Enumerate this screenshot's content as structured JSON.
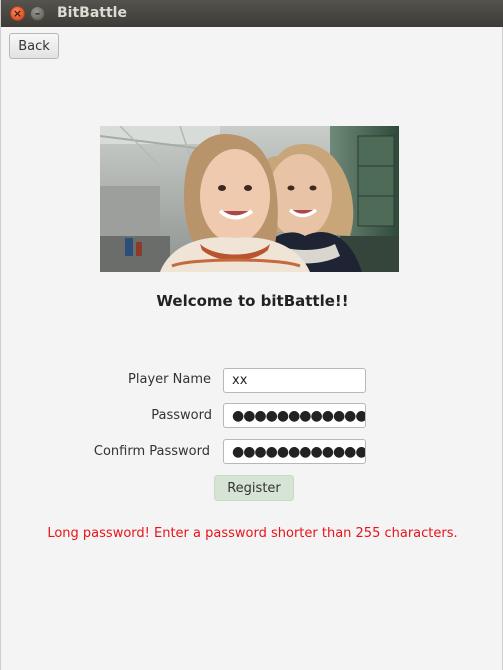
{
  "window": {
    "title": "BitBattle",
    "close_glyph": "×",
    "minimize_glyph": "–"
  },
  "nav": {
    "back_label": "Back"
  },
  "welcome_text": "Welcome to bitBattle!!",
  "form": {
    "player_name_label": "Player Name",
    "player_name_value": "xx",
    "password_label": "Password",
    "password_mask": "●●●●●●●●●●●●●●",
    "confirm_password_label": "Confirm Password",
    "confirm_password_mask": "●●●●●●●●●●●●●●",
    "register_label": "Register"
  },
  "error_message": "Long password! Enter a password shorter than 255 characters.",
  "colors": {
    "error": "#e8131b",
    "register_button": "#d5e4d4",
    "titlebar": "#3c3b37",
    "close_button": "#e0552b"
  }
}
